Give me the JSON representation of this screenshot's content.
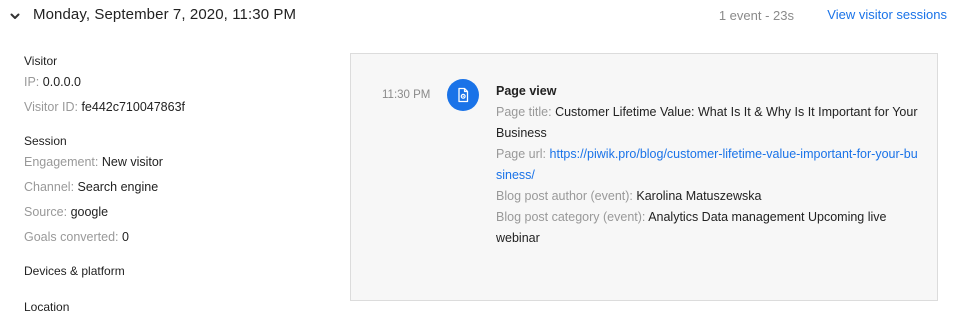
{
  "header": {
    "title": "Monday, September 7, 2020, 11:30 PM",
    "meta": "1 event - 23s",
    "link": "View visitor sessions"
  },
  "details": {
    "visitor": {
      "title": "Visitor",
      "ip_label": "IP:",
      "ip_value": "0.0.0.0",
      "id_label": "Visitor ID:",
      "id_value": "fe442c710047863f"
    },
    "session": {
      "title": "Session",
      "engagement_label": "Engagement:",
      "engagement_value": "New visitor",
      "channel_label": "Channel:",
      "channel_value": "Search engine",
      "source_label": "Source:",
      "source_value": "google",
      "goals_label": "Goals converted:",
      "goals_value": "0"
    },
    "devices_title": "Devices & platform",
    "location_title": "Location"
  },
  "event": {
    "time": "11:30 PM",
    "icon": "page-view-icon",
    "title": "Page view",
    "page_title_label": "Page title:",
    "page_title_value": "Customer Lifetime Value: What Is It & Why Is It Important for Your Business",
    "page_url_label": "Page url:",
    "page_url_value": "https://piwik.pro/blog/customer-lifetime-value-important-for-your-business/",
    "author_label": "Blog post author (event):",
    "author_value": "Karolina Matuszewska",
    "category_label": "Blog post category (event):",
    "category_value": "Analytics Data management Upcoming live webinar"
  },
  "colors": {
    "accent": "#1a73e8",
    "muted": "#999999",
    "panel_bg": "#f7f7f7",
    "panel_border": "#dcdcdc"
  }
}
